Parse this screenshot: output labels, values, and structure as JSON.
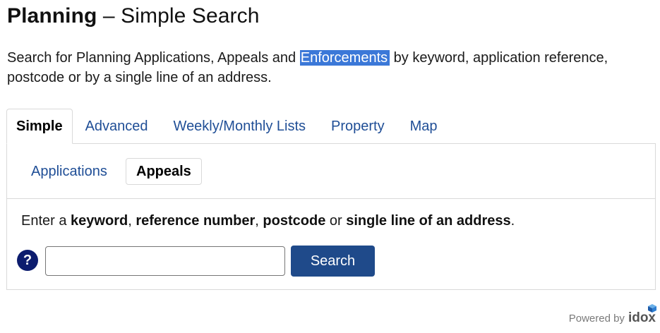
{
  "page": {
    "title_bold": "Planning",
    "title_rest": " – Simple Search",
    "intro_before": "Search for Planning Applications, Appeals and ",
    "intro_highlight": "Enforcements",
    "intro_after": " by keyword, application reference, postcode or by a single line of an address."
  },
  "tabs": [
    {
      "label": "Simple",
      "active": true
    },
    {
      "label": "Advanced"
    },
    {
      "label": "Weekly/Monthly Lists"
    },
    {
      "label": "Property"
    },
    {
      "label": "Map"
    }
  ],
  "subtabs": [
    {
      "label": "Applications"
    },
    {
      "label": "Appeals",
      "active": true
    }
  ],
  "search": {
    "instruction": {
      "p1": "Enter a ",
      "b1": "keyword",
      "p2": ", ",
      "b2": "reference number",
      "p3": ", ",
      "b3": "postcode",
      "p4": " or ",
      "b4": "single line of an address",
      "p5": "."
    },
    "help_glyph": "?",
    "value": "",
    "button_label": "Search"
  },
  "footer": {
    "powered_by": "Powered by",
    "brand": "idox"
  },
  "colors": {
    "link": "#1f4e96",
    "button": "#1f4a8a",
    "help_icon": "#0c1c6e",
    "highlight": "#3b78d8"
  }
}
